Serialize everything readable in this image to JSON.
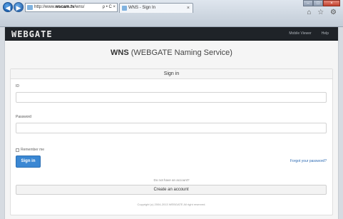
{
  "browser": {
    "address": {
      "prefix": "http://www.",
      "host": "wscam.tv",
      "suffix": "/wns/",
      "controls": "ρ • C ×"
    },
    "tab": {
      "title": "WNS - Sign In",
      "close": "×"
    },
    "window_buttons": {
      "minimize": "–",
      "maximize": "□",
      "close": "×"
    },
    "toolbar_icons": [
      "home-icon",
      "star-icon",
      "gear-icon"
    ],
    "toolbar_glyphs": "⌂ ☆ ⚙"
  },
  "navbar": {
    "brand": "WEBGATE",
    "links": [
      "Mobile Viewer",
      "Help"
    ]
  },
  "page": {
    "title_strong": "WNS",
    "title_rest": " (WEBGATE Naming Service)"
  },
  "form": {
    "header": "Sign in",
    "id_label": "ID",
    "password_label": "Password",
    "remember_label": "Remember me",
    "signin_button": "Sign in",
    "forgot_link": "Forgot your password?",
    "no_account_text": "Do not have an account?",
    "create_button": "Create an account"
  },
  "footer": {
    "copyright": "Copyright (c) 2004-2013 WEBGATE All right reserved."
  },
  "colors": {
    "navbar_bg": "#1f2328",
    "primary_button": "#3a87d3",
    "link": "#2d6bb3"
  }
}
